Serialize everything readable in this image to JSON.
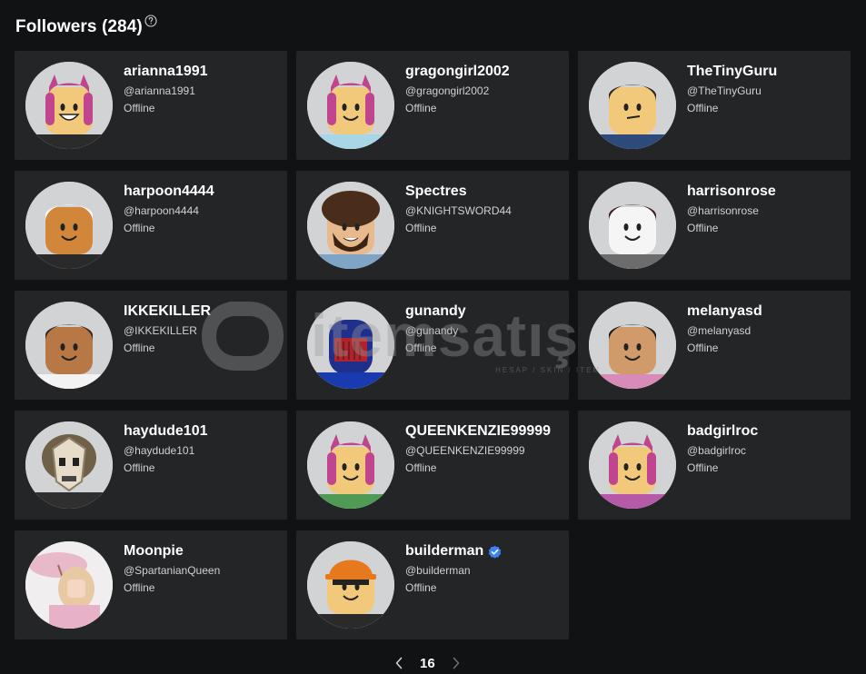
{
  "header": {
    "title": "Followers (284)",
    "help_icon": "question-circle-icon"
  },
  "followers": [
    {
      "display_name": "arianna1991",
      "username": "@arianna1991",
      "status": "Offline",
      "verified": false,
      "hair": "#c0458e",
      "skin": "#f2c97a",
      "shirt": "#2b2b2b",
      "bg": "#d2d3d5",
      "face": "grin"
    },
    {
      "display_name": "gragongirl2002",
      "username": "@gragongirl2002",
      "status": "Offline",
      "verified": false,
      "hair": "#c0458e",
      "skin": "#f2c97a",
      "shirt": "#a9d6e6",
      "bg": "#d2d3d5",
      "face": "smile"
    },
    {
      "display_name": "TheTinyGuru",
      "username": "@TheTinyGuru",
      "status": "Offline",
      "verified": false,
      "hair": "#2e2520",
      "skin": "#f2c97a",
      "shirt": "#2e4a7a",
      "bg": "#d2d3d5",
      "face": "smirk"
    },
    {
      "display_name": "harpoon4444",
      "username": "@harpoon4444",
      "status": "Offline",
      "verified": false,
      "hair": "#ffffff",
      "skin": "#d1863a",
      "shirt": "#2a2a2a",
      "bg": "#d2d3d5",
      "face": "smile"
    },
    {
      "display_name": "Spectres",
      "username": "@KNIGHTSWORD44",
      "status": "Offline",
      "verified": false,
      "hair": "#4a2c1a",
      "skin": "#e8b98d",
      "shirt": "#7fa4c6",
      "bg": "#d2d3d5",
      "face": "beard"
    },
    {
      "display_name": "harrisonrose",
      "username": "@harrisonrose",
      "status": "Offline",
      "verified": false,
      "hair": "#3a2020",
      "skin": "#f5f5f5",
      "shirt": "#6c6c6c",
      "bg": "#d2d3d5",
      "face": "smile"
    },
    {
      "display_name": "IKKEKILLER",
      "username": "@IKKEKILLER",
      "status": "Offline",
      "verified": false,
      "hair": "#3a2a25",
      "skin": "#b87845",
      "shirt": "#f3f3f3",
      "bg": "#d2d3d5",
      "face": "smile"
    },
    {
      "display_name": "gunandy",
      "username": "@gunandy",
      "status": "Offline",
      "verified": false,
      "hair": "#1e2f8c",
      "skin": "#b3222a",
      "shirt": "#1a3ab0",
      "bg": "#d2d3d5",
      "face": "helmet"
    },
    {
      "display_name": "melanyasd",
      "username": "@melanyasd",
      "status": "Offline",
      "verified": false,
      "hair": "#1e1a1a",
      "skin": "#d09a6a",
      "shirt": "#d88ab8",
      "bg": "#d2d3d5",
      "face": "smile"
    },
    {
      "display_name": "haydude101",
      "username": "@haydude101",
      "status": "Offline",
      "verified": false,
      "hair": "#8a7a5a",
      "skin": "#e6dcc8",
      "shirt": "#2f2f2f",
      "bg": "#d2d3d5",
      "face": "mask"
    },
    {
      "display_name": "QUEENKENZIE99999",
      "username": "@QUEENKENZIE99999",
      "status": "Offline",
      "verified": false,
      "hair": "#c0458e",
      "skin": "#f2c97a",
      "shirt": "#4f9a55",
      "bg": "#d2d3d5",
      "face": "smile"
    },
    {
      "display_name": "badgirlroc",
      "username": "@badgirlroc",
      "status": "Offline",
      "verified": false,
      "hair": "#c0458e",
      "skin": "#f2c97a",
      "shirt": "#b65aa8",
      "bg": "#d2d3d5",
      "face": "smile"
    },
    {
      "display_name": "Moonpie",
      "username": "@SpartanianQueen",
      "status": "Offline",
      "verified": false,
      "hair": "#e8c9a3",
      "skin": "#f3d7c2",
      "shirt": "#e7b2c8",
      "bg": "#d2d3d5",
      "face": "parasol"
    },
    {
      "display_name": "builderman",
      "username": "@builderman",
      "status": "Offline",
      "verified": true,
      "hair": "#e6781e",
      "skin": "#f2c97a",
      "shirt": "#2a2a2a",
      "bg": "#d2d3d5",
      "face": "hardhat"
    }
  ],
  "pager": {
    "prev_icon": "chevron-left-icon",
    "page": "16",
    "next_icon": "chevron-right-icon"
  },
  "watermark": {
    "brand": "itemsatış",
    "tagline": "HESAP / SKIN / ITEM"
  }
}
